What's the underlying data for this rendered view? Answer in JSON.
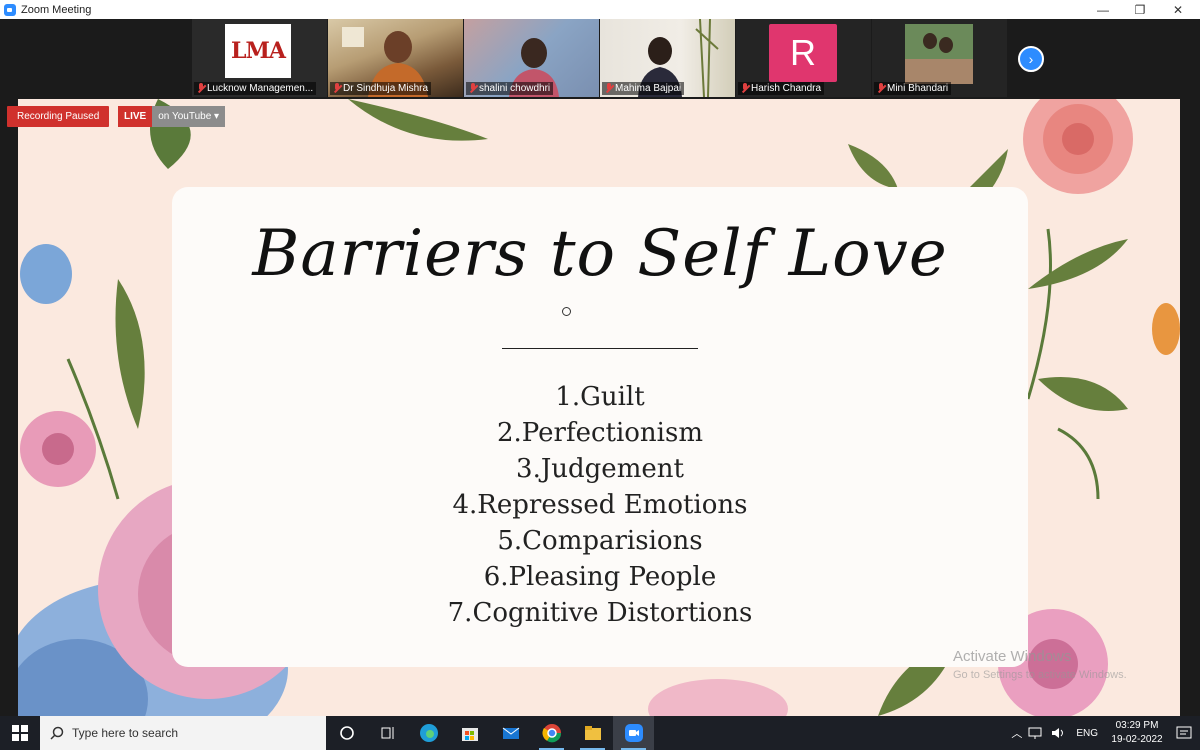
{
  "window": {
    "title": "Zoom Meeting",
    "controls": {
      "minimize": "—",
      "restore": "❐",
      "close": "✕"
    }
  },
  "participants": [
    {
      "name": "Lucknow Managemen...",
      "logo_text": "LMA",
      "muted": true,
      "active": false
    },
    {
      "name": "Dr Sindhuja Mishra",
      "muted": true,
      "active": true
    },
    {
      "name": "shalini chowdhri",
      "muted": true,
      "active": false
    },
    {
      "name": "Mahima Bajpai",
      "muted": true,
      "active": false
    },
    {
      "name": "Harish Chandra",
      "avatar_letter": "R",
      "muted": true,
      "active": false
    },
    {
      "name": "Mini Bhandari",
      "muted": true,
      "active": false
    }
  ],
  "gallery_next_icon": "›",
  "recording": {
    "status": "Recording Paused"
  },
  "live": {
    "badge": "LIVE",
    "platform": "on YouTube",
    "dropdown": "▾"
  },
  "slide": {
    "title": "Barriers to Self Love",
    "items": [
      "1.Guilt",
      "2.Perfectionism",
      "3.Judgement",
      "4.Repressed Emotions",
      "5.Comparisions",
      "6.Pleasing People",
      "7.Cognitive Distortions"
    ]
  },
  "watermark": {
    "line1": "Activate Windows",
    "line2": "Go to Settings to activate Windows."
  },
  "taskbar": {
    "search_placeholder": "Type here to search",
    "tray": {
      "language": "ENG",
      "time": "03:29 PM",
      "date": "19-02-2022"
    }
  },
  "colors": {
    "zoom_blue": "#2d8cff",
    "recording_red": "#d0312d",
    "avatar_pink": "#e0366e",
    "slide_bg": "#fbe9df"
  }
}
